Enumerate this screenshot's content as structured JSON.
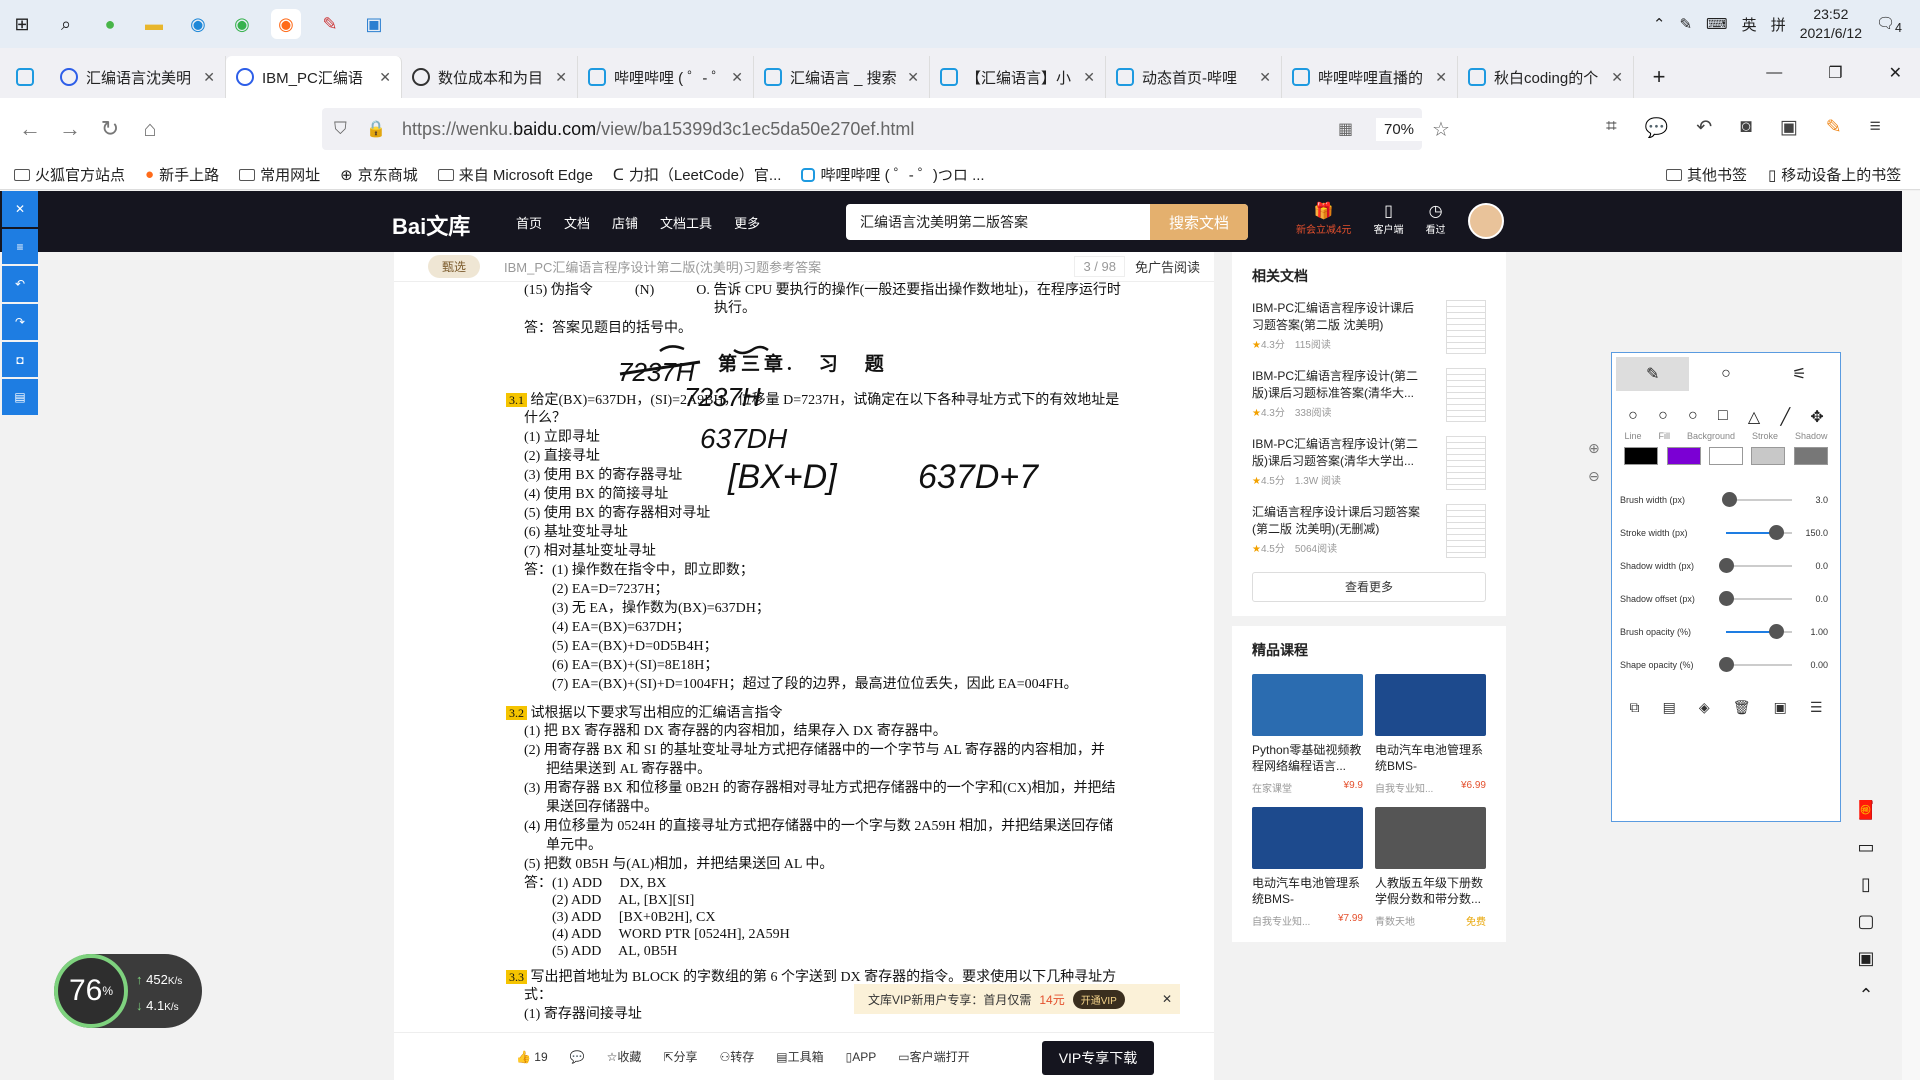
{
  "taskbar": {
    "time": "23:52",
    "date": "2021/6/12",
    "ime1": "英",
    "ime2": "拼",
    "notif_count": "4"
  },
  "tabs": [
    {
      "label": "汇编语言沈美明"
    },
    {
      "label": "IBM_PC汇编语"
    },
    {
      "label": "数位成本和为目"
    },
    {
      "label": "哔哩哔哩 ( ゜- ゜"
    },
    {
      "label": "汇编语言 _ 搜索"
    },
    {
      "label": "【汇编语言】小"
    },
    {
      "label": "动态首页-哔哩"
    },
    {
      "label": "哔哩哔哩直播的"
    },
    {
      "label": "秋白coding的个"
    }
  ],
  "url": {
    "prefix": "https://wenku.",
    "domain": "baidu.com",
    "path": "/view/ba15399d3c1ec5da50e270ef.html",
    "zoom": "70%"
  },
  "bookmarks": [
    "火狐官方站点",
    "新手上路",
    "常用网址",
    "京东商城",
    "来自 Microsoft Edge",
    "力扣（LeetCode）官...",
    "哔哩哔哩 ( ゜- ゜)つロ ...",
    "其他书签",
    "移动设备上的书签"
  ],
  "site": {
    "logo": "Bai文库",
    "nav": [
      "首页",
      "文档",
      "店铺",
      "文档工具",
      "更多"
    ],
    "search_value": "汇编语言沈美明第二版答案",
    "search_btn": "搜索文档",
    "icons": [
      "新会立减4元",
      "客户端",
      "看过"
    ]
  },
  "doc": {
    "badge": "甄选",
    "title": "IBM_PC汇编语言程序设计第二版(沈美明)习题参考答案",
    "page": "3 / 98",
    "noad": "免广告阅读",
    "lines": [
      "(15) 伪指令　　　(N)　　　O. 告诉 CPU 要执行的操作(一般还要指出操作数地址)，在程序运行时",
      "执行。",
      "答：答案见题目的括号中。",
      "第三章.　习　题",
      "给定(BX)=637DH，(SI)=2A9BH，位移量 D=7237H，试确定在以下各种寻址方式下的有效地址是",
      "什么？",
      "(1) 立即寻址",
      "(2) 直接寻址",
      "(3) 使用 BX 的寄存器寻址",
      "(4) 使用 BX 的简接寻址",
      "(5) 使用 BX 的寄存器相对寻址",
      "(6) 基址变址寻址",
      "(7) 相对基址变址寻址",
      "答：(1) 操作数在指令中，即立即数；",
      "(2) EA=D=7237H；",
      "(3) 无 EA，操作数为(BX)=637DH；",
      "(4) EA=(BX)=637DH；",
      "(5) EA=(BX)+D=0D5B4H；",
      "(6) EA=(BX)+(SI)=8E18H；",
      "(7) EA=(BX)+(SI)+D=1004FH；超过了段的边界，最高进位位丢失，因此 EA=004FH。",
      "试根据以下要求写出相应的汇编语言指令",
      "(1) 把 BX 寄存器和 DX 寄存器的内容相加，结果存入 DX 寄存器中。",
      "(2) 用寄存器 BX 和 SI 的基址变址寻址方式把存储器中的一个字节与 AL 寄存器的内容相加，并",
      "把结果送到 AL 寄存器中。",
      "(3) 用寄存器 BX 和位移量 0B2H 的寄存器相对寻址方式把存储器中的一个字和(CX)相加，并把结",
      "果送回存储器中。",
      "(4) 用位移量为 0524H 的直接寻址方式把存储器中的一个字与数 2A59H 相加，并把结果送回存储",
      "单元中。",
      "(5) 把数 0B5H 与(AL)相加，并把结果送回 AL 中。",
      "答：(1) ADD　 DX, BX",
      "(2) ADD　 AL, [BX][SI]",
      "(3) ADD　 [BX+0B2H], CX",
      "(4) ADD　 WORD PTR [0524H], 2A59H",
      "(5) ADD　 AL, 0B5H",
      "写出把首地址为 BLOCK 的字数组的第 6 个字送到 DX 寄存器的指令。要求使用以下几种寻址方",
      "式：",
      "(1) 寄存器间接寻址"
    ],
    "qnums": [
      "3.1",
      "3.2",
      "3.3"
    ],
    "handwriting": [
      "7237H",
      "7237H",
      "637DH",
      "[BX+D]",
      "637D+7"
    ],
    "vip_banner": "文库VIP新用户专享：首月仅需",
    "vip_price": "14元",
    "vip_open": "开通VIP",
    "footer": [
      "19",
      "",
      "收藏",
      "分享",
      "转存",
      "工具箱",
      "APP",
      "客户端打开"
    ],
    "vip_download": "VIP专享下载"
  },
  "side": {
    "related_title": "相关文档",
    "related": [
      {
        "t": "IBM-PC汇编语言程序设计课后习题答案(第二版 沈美明)",
        "score": "4.3分",
        "reads": "115阅读"
      },
      {
        "t": "IBM-PC汇编语言程序设计(第二版)课后习题标准答案(清华大...",
        "score": "4.3分",
        "reads": "338阅读"
      },
      {
        "t": "IBM-PC汇编语言程序设计(第二版)课后习题答案(清华大学出...",
        "score": "4.5分",
        "reads": "1.3W 阅读"
      },
      {
        "t": "汇编语言程序设计课后习题答案(第二版 沈美明)(无删减)",
        "score": "4.5分",
        "reads": "5064阅读"
      }
    ],
    "more": "查看更多",
    "course_title": "精品课程",
    "courses": [
      {
        "t": "Python零基础视频教程网络编程语言...",
        "src": "在家课堂",
        "price": "¥9.9"
      },
      {
        "t": "电动汽车电池管理系统BMS-",
        "src": "自我专业知...",
        "price": "¥6.99"
      },
      {
        "t": "电动汽车电池管理系统BMS-",
        "src": "自我专业知...",
        "price": "¥7.99"
      },
      {
        "t": "人教版五年级下册数学假分数和带分数...",
        "src": "青数天地",
        "price": "免费"
      }
    ]
  },
  "tool": {
    "labels": [
      "Line",
      "Fill",
      "Background",
      "Stroke",
      "Shadow"
    ],
    "colors": [
      "#000000",
      "#7b00d4",
      "#ffffff",
      "#c8c8c8",
      "#777777"
    ],
    "sliders": [
      {
        "n": "Brush width (px)",
        "v": "3.0",
        "f": 0.04
      },
      {
        "n": "Stroke width (px)",
        "v": "150.0",
        "f": 0.75
      },
      {
        "n": "Shadow width (px)",
        "v": "0.0",
        "f": 0
      },
      {
        "n": "Shadow offset (px)",
        "v": "0.0",
        "f": 0
      },
      {
        "n": "Brush opacity (%)",
        "v": "1.00",
        "f": 0.75
      },
      {
        "n": "Shape opacity (%)",
        "v": "0.00",
        "f": 0
      }
    ]
  },
  "net": {
    "pct": "76",
    "unit": "%",
    "up": "452",
    "up_u": "K/s",
    "down": "4.1",
    "down_u": "K/s"
  }
}
